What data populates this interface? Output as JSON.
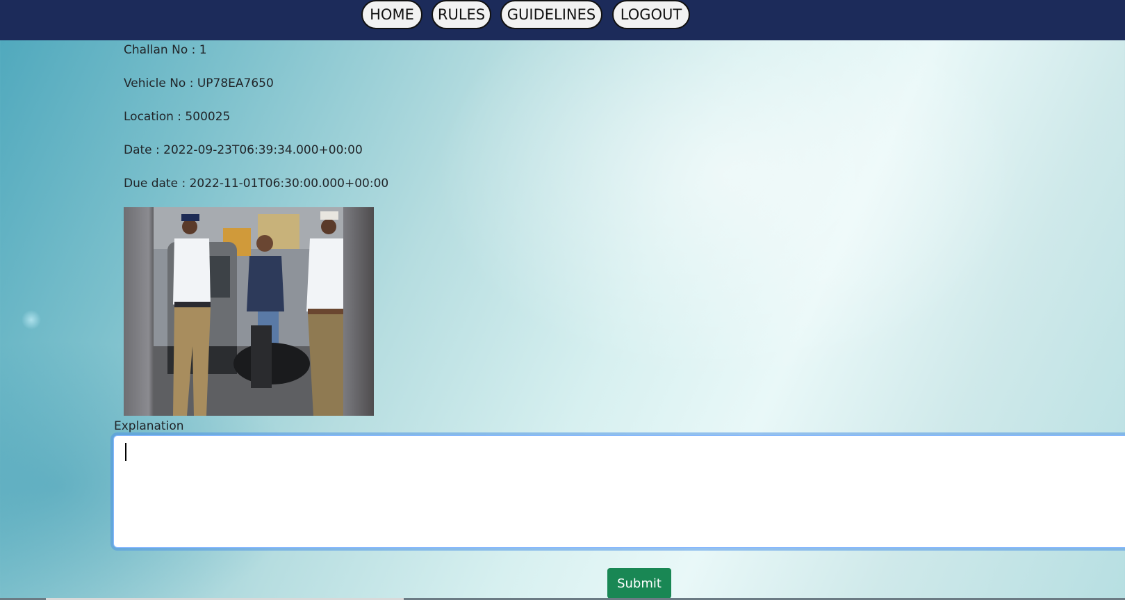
{
  "nav": {
    "items": [
      {
        "label": "HOME"
      },
      {
        "label": "RULES"
      },
      {
        "label": "GUIDELINES"
      },
      {
        "label": "LOGOUT"
      }
    ]
  },
  "challan": {
    "challan_no": "Challan No : 1",
    "vehicle_no": "Vehicle No : UP78EA7650",
    "location": "Location : 500025",
    "date": "Date : 2022-09-23T06:39:34.000+00:00",
    "due_date": "Due date : 2022-11-01T06:30:00.000+00:00"
  },
  "form": {
    "explanation_label": "Explanation",
    "explanation_value": "",
    "submit_label": "Submit"
  }
}
